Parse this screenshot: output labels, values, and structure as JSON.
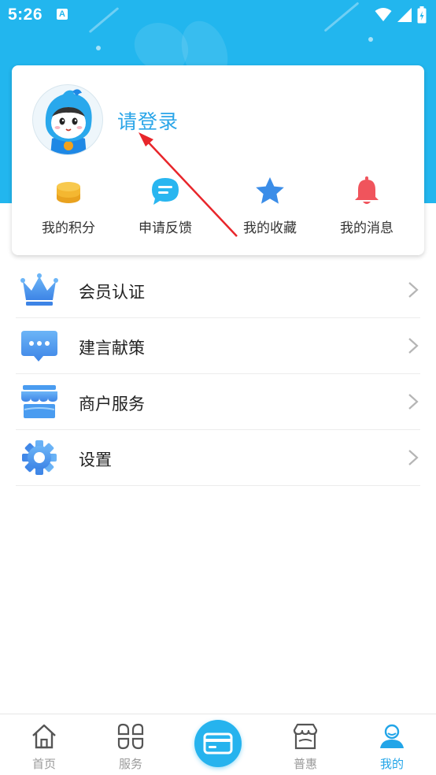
{
  "status_bar": {
    "time": "5:26",
    "notification_badge": "A"
  },
  "profile": {
    "login_text": "请登录"
  },
  "quick_actions": [
    {
      "label": "我的积分",
      "icon": "coins-stack-icon"
    },
    {
      "label": "申请反馈",
      "icon": "chat-bubble-icon"
    },
    {
      "label": "我的收藏",
      "icon": "star-icon"
    },
    {
      "label": "我的消息",
      "icon": "bell-icon"
    }
  ],
  "menu": [
    {
      "label": "会员认证",
      "icon": "crown-icon"
    },
    {
      "label": "建言献策",
      "icon": "message-dots-icon"
    },
    {
      "label": "商户服务",
      "icon": "storefront-icon"
    },
    {
      "label": "设置",
      "icon": "gear-icon"
    }
  ],
  "bottom_nav": [
    {
      "label": "首页",
      "icon": "home-icon",
      "active": false
    },
    {
      "label": "服务",
      "icon": "grid-flower-icon",
      "active": false
    },
    {
      "label": "",
      "icon": "card-icon",
      "active": false
    },
    {
      "label": "普惠",
      "icon": "shop-icon",
      "active": false
    },
    {
      "label": "我的",
      "icon": "user-icon",
      "active": true
    }
  ],
  "colors": {
    "primary": "#22b6ee",
    "login_text": "#2aa5e8",
    "coins": "#f4b731",
    "chat": "#29b6f0",
    "star": "#3b8de8",
    "bell": "#f0545c",
    "menu_icon": "#4a9cf0",
    "arrow": "#e8262b",
    "nav_inactive": "#9a9a9a",
    "nav_active": "#22a5e8"
  }
}
